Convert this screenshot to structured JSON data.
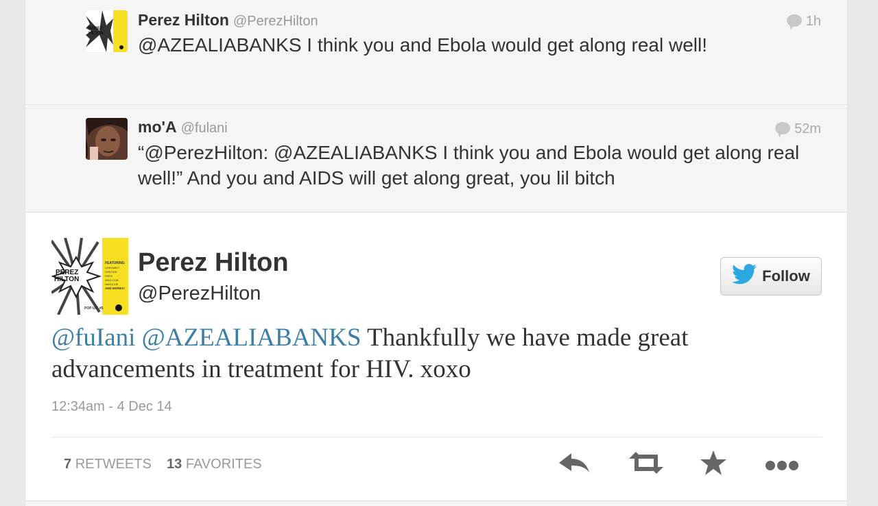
{
  "context_tweets": [
    {
      "name": "Perez Hilton",
      "handle": "@PerezHilton",
      "time": "1h",
      "text": "@AZEALIABANKS I think you and Ebola would get along real well!"
    },
    {
      "name": "mo'A",
      "handle": "@fulani",
      "time": "52m",
      "text": "“@PerezHilton: @AZEALIABANKS I think you and Ebola would get along real well!” And you and AIDS will get along great, you lil bitch"
    }
  ],
  "main_tweet": {
    "name": "Perez Hilton",
    "handle": "@PerezHilton",
    "follow_label": "Follow",
    "mention1": "@fuIani",
    "mention2": "@AZEALIABANKS",
    "text_rest": " Thankfully we have made great advancements in treatment for HIV. xoxo",
    "timestamp": "12:34am - 4 Dec 14",
    "retweets_count": "7",
    "retweets_label": "RETWEETS",
    "favorites_count": "13",
    "favorites_label": "FAVORITES"
  },
  "icons": {
    "reply": "reply-icon",
    "retweet": "retweet-icon",
    "favorite": "star-icon",
    "more": "more-icon",
    "bird": "twitter-bird-icon"
  },
  "colors": {
    "mention": "#3b7fa8",
    "twitter_blue": "#2aa9e0",
    "icon_gray": "#666666"
  }
}
